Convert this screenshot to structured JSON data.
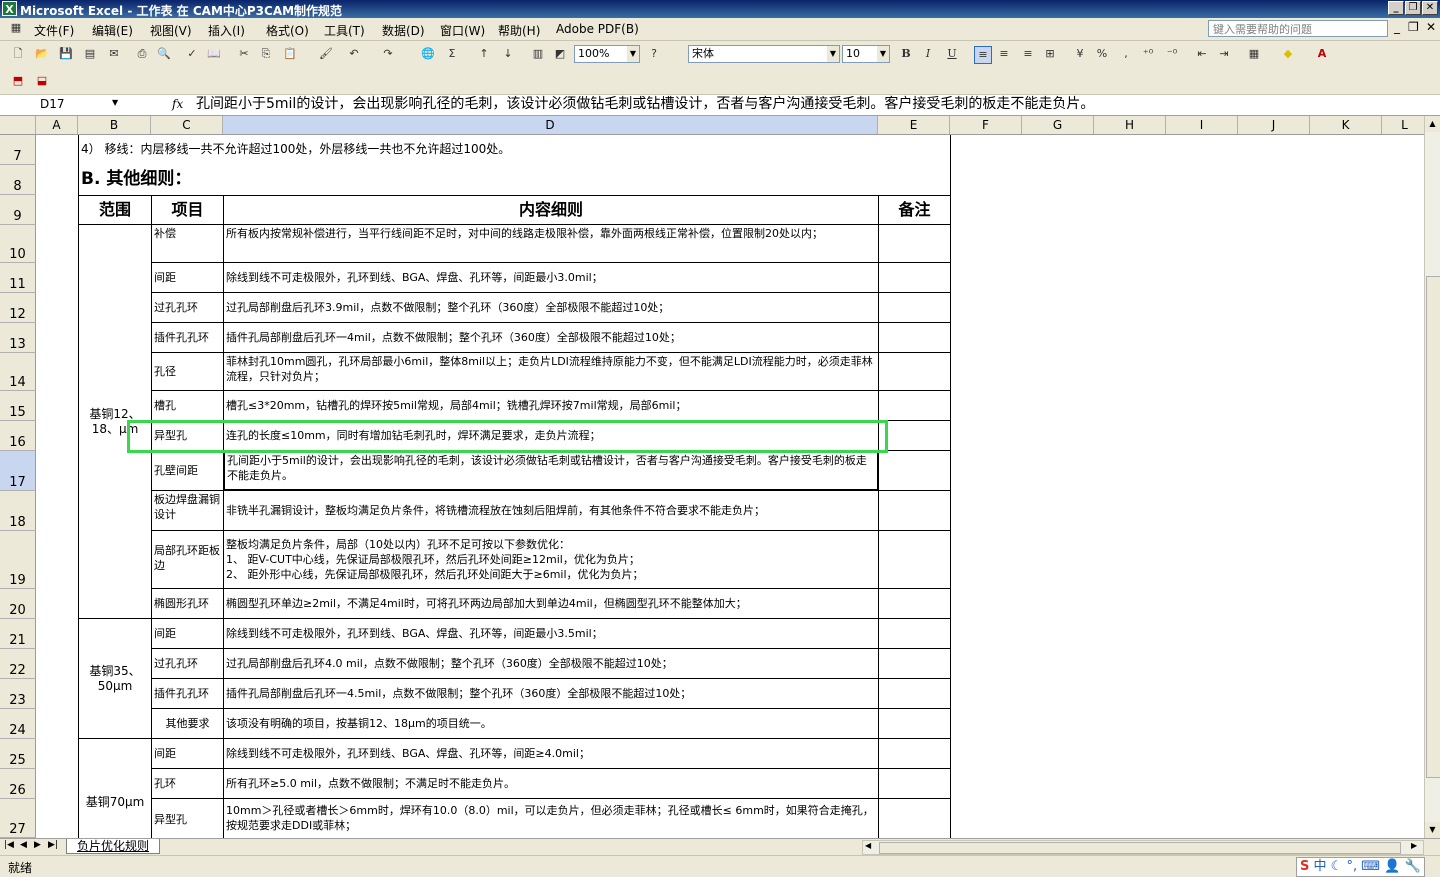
{
  "window": {
    "title": "Microsoft Excel - 工作表 在 CAM中心P3CAM制作规范"
  },
  "menu": {
    "items": [
      "文件(F)",
      "编辑(E)",
      "视图(V)",
      "插入(I)",
      "格式(O)",
      "工具(T)",
      "数据(D)",
      "窗口(W)",
      "帮助(H)",
      "Adobe PDF(B)"
    ],
    "help_placeholder": "键入需要帮助的问题"
  },
  "toolbar": {
    "zoom": "100%",
    "font_name": "宋体",
    "font_size": "10",
    "bold": "B",
    "italic": "I",
    "underline": "U",
    "percent": "%",
    "comma": ","
  },
  "formula_bar": {
    "name_box": "D17",
    "fx": "fx",
    "content": "孔间距小于5mil的设计，会出现影响孔径的毛刺，该设计必须做钻毛刺或钻槽设计，否者与客户沟通接受毛刺。客户接受毛刺的板走不能走负片。"
  },
  "columns": [
    "A",
    "B",
    "C",
    "D",
    "E",
    "F",
    "G",
    "H",
    "I",
    "J",
    "K",
    "L"
  ],
  "rows": [
    "7",
    "8",
    "9",
    "10",
    "11",
    "12",
    "13",
    "14",
    "15",
    "16",
    "17",
    "18",
    "19",
    "20",
    "21",
    "22",
    "23",
    "24",
    "25",
    "26",
    "27"
  ],
  "sheet": {
    "row7_text": "4） 移线：内层移线一共不允许超过100处，外层移线一共也不允许超过100处。",
    "section_title": "B.  其他细则：",
    "headers": {
      "scope": "范围",
      "item": "项目",
      "content": "内容细则",
      "remark": "备注"
    },
    "group1": {
      "scope": "基铜12、18、μm",
      "rows": [
        {
          "item": "补偿",
          "content": "所有板内按常规补偿进行，当平行线间距不足时，对中间的线路走极限补偿，靠外面两根线正常补偿，位置限制20处以内；"
        },
        {
          "item": "间距",
          "content": "除线到线不可走极限外，孔环到线、BGA、焊盘、孔环等，间距最小3.0mil；"
        },
        {
          "item": "过孔孔环",
          "content": "过孔局部削盘后孔环3.9mil，点数不做限制；整个孔环（360度）全部极限不能超过10处；"
        },
        {
          "item": "插件孔孔环",
          "content": "插件孔局部削盘后孔环一4mil，点数不做限制；整个孔环（360度）全部极限不能超过10处；"
        },
        {
          "item": "孔径",
          "content": "菲林封孔10mm圆孔，孔环局部最小6mil，整体8mil以上；走负片LDI流程维持原能力不变，但不能满足LDI流程能力时，必须走菲林流程，只针对负片；"
        },
        {
          "item": "槽孔",
          "content": "槽孔≤3*20mm，钻槽孔的焊环按5mil常规，局部4mil；铣槽孔焊环按7mil常规，局部6mil；"
        },
        {
          "item": "异型孔",
          "content": "连孔的长度≤10mm，同时有增加钻毛刺孔时，焊环满足要求，走负片流程；"
        },
        {
          "item": "孔壁间距",
          "content": "孔间距小于5mil的设计，会出现影响孔径的毛刺，该设计必须做钻毛刺或钻槽设计，否者与客户沟通接受毛刺。客户接受毛刺的板走不能走负片。"
        },
        {
          "item": "板边焊盘漏铜设计",
          "content": "非铣半孔漏铜设计，整板均满足负片条件，将铣槽流程放在蚀刻后阻焊前，有其他条件不符合要求不能走负片；"
        },
        {
          "item": "局部孔环距板边",
          "content_lines": [
            "整板均满足负片条件，局部（10处以内）孔环不足可按以下参数优化：",
            "1、  距V-CUT中心线，先保证局部极限孔环，然后孔环处间距≥12mil，优化为负片；",
            "2、  距外形中心线，先保证局部极限孔环，然后孔环处间距大于≥6mil，优化为负片；"
          ]
        },
        {
          "item": "椭圆形孔环",
          "content": "椭圆型孔环单边≥2mil，不满足4mil时，可将孔环两边局部加大到单边4mil，但椭圆型孔环不能整体加大；"
        }
      ]
    },
    "group2": {
      "scope": "基铜35、50μm",
      "rows": [
        {
          "item": "间距",
          "content": "除线到线不可走极限外，孔环到线、BGA、焊盘、孔环等，间距最小3.5mil；"
        },
        {
          "item": "过孔孔环",
          "content": "过孔局部削盘后孔环4.0 mil，点数不做限制；整个孔环（360度）全部极限不能超过10处；"
        },
        {
          "item": "插件孔孔环",
          "content": "插件孔局部削盘后孔环一4.5mil，点数不做限制；整个孔环（360度）全部极限不能超过10处；"
        },
        {
          "item": "其他要求",
          "content": "该项没有明确的项目，按基铜12、18μm的项目统一。"
        }
      ]
    },
    "group3": {
      "scope": "基铜70μm",
      "rows": [
        {
          "item": "间距",
          "content": "除线到线不可走极限外，孔环到线、BGA、焊盘、孔环等，间距≥4.0mil；"
        },
        {
          "item": "孔环",
          "content": "所有孔环≥5.0 mil，点数不做限制；不满足时不能走负片。"
        },
        {
          "item": "异型孔",
          "content": "10mm＞孔径或者槽长＞6mm时，焊环有10.0（8.0）mil，可以走负片，但必须走菲林；孔径或槽长≤ 6mm时，如果符合走掩孔，按规范要求走DDI或菲林；"
        }
      ]
    }
  },
  "sheet_tab": "负片优化规则",
  "status": "就绪",
  "ime": "中"
}
